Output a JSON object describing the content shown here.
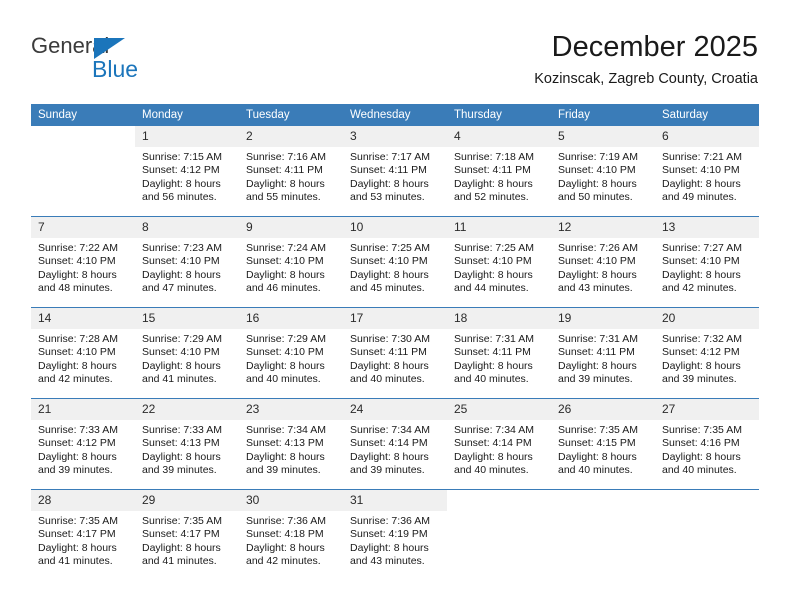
{
  "brand": {
    "name_part1": "General",
    "name_part2": "Blue",
    "accent_color": "#1b75bb"
  },
  "header": {
    "title": "December 2025",
    "subtitle": "Kozinscak, Zagreb County, Croatia"
  },
  "calendar": {
    "header_color": "#3a7cb8",
    "weekdays": [
      "Sunday",
      "Monday",
      "Tuesday",
      "Wednesday",
      "Thursday",
      "Friday",
      "Saturday"
    ],
    "weeks": [
      [
        {
          "day": "",
          "sunrise": "",
          "sunset": "",
          "daylight": "",
          "blank": true
        },
        {
          "day": "1",
          "sunrise": "Sunrise: 7:15 AM",
          "sunset": "Sunset: 4:12 PM",
          "daylight": "Daylight: 8 hours and 56 minutes."
        },
        {
          "day": "2",
          "sunrise": "Sunrise: 7:16 AM",
          "sunset": "Sunset: 4:11 PM",
          "daylight": "Daylight: 8 hours and 55 minutes."
        },
        {
          "day": "3",
          "sunrise": "Sunrise: 7:17 AM",
          "sunset": "Sunset: 4:11 PM",
          "daylight": "Daylight: 8 hours and 53 minutes."
        },
        {
          "day": "4",
          "sunrise": "Sunrise: 7:18 AM",
          "sunset": "Sunset: 4:11 PM",
          "daylight": "Daylight: 8 hours and 52 minutes."
        },
        {
          "day": "5",
          "sunrise": "Sunrise: 7:19 AM",
          "sunset": "Sunset: 4:10 PM",
          "daylight": "Daylight: 8 hours and 50 minutes."
        },
        {
          "day": "6",
          "sunrise": "Sunrise: 7:21 AM",
          "sunset": "Sunset: 4:10 PM",
          "daylight": "Daylight: 8 hours and 49 minutes."
        }
      ],
      [
        {
          "day": "7",
          "sunrise": "Sunrise: 7:22 AM",
          "sunset": "Sunset: 4:10 PM",
          "daylight": "Daylight: 8 hours and 48 minutes."
        },
        {
          "day": "8",
          "sunrise": "Sunrise: 7:23 AM",
          "sunset": "Sunset: 4:10 PM",
          "daylight": "Daylight: 8 hours and 47 minutes."
        },
        {
          "day": "9",
          "sunrise": "Sunrise: 7:24 AM",
          "sunset": "Sunset: 4:10 PM",
          "daylight": "Daylight: 8 hours and 46 minutes."
        },
        {
          "day": "10",
          "sunrise": "Sunrise: 7:25 AM",
          "sunset": "Sunset: 4:10 PM",
          "daylight": "Daylight: 8 hours and 45 minutes."
        },
        {
          "day": "11",
          "sunrise": "Sunrise: 7:25 AM",
          "sunset": "Sunset: 4:10 PM",
          "daylight": "Daylight: 8 hours and 44 minutes."
        },
        {
          "day": "12",
          "sunrise": "Sunrise: 7:26 AM",
          "sunset": "Sunset: 4:10 PM",
          "daylight": "Daylight: 8 hours and 43 minutes."
        },
        {
          "day": "13",
          "sunrise": "Sunrise: 7:27 AM",
          "sunset": "Sunset: 4:10 PM",
          "daylight": "Daylight: 8 hours and 42 minutes."
        }
      ],
      [
        {
          "day": "14",
          "sunrise": "Sunrise: 7:28 AM",
          "sunset": "Sunset: 4:10 PM",
          "daylight": "Daylight: 8 hours and 42 minutes."
        },
        {
          "day": "15",
          "sunrise": "Sunrise: 7:29 AM",
          "sunset": "Sunset: 4:10 PM",
          "daylight": "Daylight: 8 hours and 41 minutes."
        },
        {
          "day": "16",
          "sunrise": "Sunrise: 7:29 AM",
          "sunset": "Sunset: 4:10 PM",
          "daylight": "Daylight: 8 hours and 40 minutes."
        },
        {
          "day": "17",
          "sunrise": "Sunrise: 7:30 AM",
          "sunset": "Sunset: 4:11 PM",
          "daylight": "Daylight: 8 hours and 40 minutes."
        },
        {
          "day": "18",
          "sunrise": "Sunrise: 7:31 AM",
          "sunset": "Sunset: 4:11 PM",
          "daylight": "Daylight: 8 hours and 40 minutes."
        },
        {
          "day": "19",
          "sunrise": "Sunrise: 7:31 AM",
          "sunset": "Sunset: 4:11 PM",
          "daylight": "Daylight: 8 hours and 39 minutes."
        },
        {
          "day": "20",
          "sunrise": "Sunrise: 7:32 AM",
          "sunset": "Sunset: 4:12 PM",
          "daylight": "Daylight: 8 hours and 39 minutes."
        }
      ],
      [
        {
          "day": "21",
          "sunrise": "Sunrise: 7:33 AM",
          "sunset": "Sunset: 4:12 PM",
          "daylight": "Daylight: 8 hours and 39 minutes."
        },
        {
          "day": "22",
          "sunrise": "Sunrise: 7:33 AM",
          "sunset": "Sunset: 4:13 PM",
          "daylight": "Daylight: 8 hours and 39 minutes."
        },
        {
          "day": "23",
          "sunrise": "Sunrise: 7:34 AM",
          "sunset": "Sunset: 4:13 PM",
          "daylight": "Daylight: 8 hours and 39 minutes."
        },
        {
          "day": "24",
          "sunrise": "Sunrise: 7:34 AM",
          "sunset": "Sunset: 4:14 PM",
          "daylight": "Daylight: 8 hours and 39 minutes."
        },
        {
          "day": "25",
          "sunrise": "Sunrise: 7:34 AM",
          "sunset": "Sunset: 4:14 PM",
          "daylight": "Daylight: 8 hours and 40 minutes."
        },
        {
          "day": "26",
          "sunrise": "Sunrise: 7:35 AM",
          "sunset": "Sunset: 4:15 PM",
          "daylight": "Daylight: 8 hours and 40 minutes."
        },
        {
          "day": "27",
          "sunrise": "Sunrise: 7:35 AM",
          "sunset": "Sunset: 4:16 PM",
          "daylight": "Daylight: 8 hours and 40 minutes."
        }
      ],
      [
        {
          "day": "28",
          "sunrise": "Sunrise: 7:35 AM",
          "sunset": "Sunset: 4:17 PM",
          "daylight": "Daylight: 8 hours and 41 minutes."
        },
        {
          "day": "29",
          "sunrise": "Sunrise: 7:35 AM",
          "sunset": "Sunset: 4:17 PM",
          "daylight": "Daylight: 8 hours and 41 minutes."
        },
        {
          "day": "30",
          "sunrise": "Sunrise: 7:36 AM",
          "sunset": "Sunset: 4:18 PM",
          "daylight": "Daylight: 8 hours and 42 minutes."
        },
        {
          "day": "31",
          "sunrise": "Sunrise: 7:36 AM",
          "sunset": "Sunset: 4:19 PM",
          "daylight": "Daylight: 8 hours and 43 minutes."
        },
        {
          "day": "",
          "sunrise": "",
          "sunset": "",
          "daylight": "",
          "blank": true
        },
        {
          "day": "",
          "sunrise": "",
          "sunset": "",
          "daylight": "",
          "blank": true
        },
        {
          "day": "",
          "sunrise": "",
          "sunset": "",
          "daylight": "",
          "blank": true
        }
      ]
    ]
  }
}
